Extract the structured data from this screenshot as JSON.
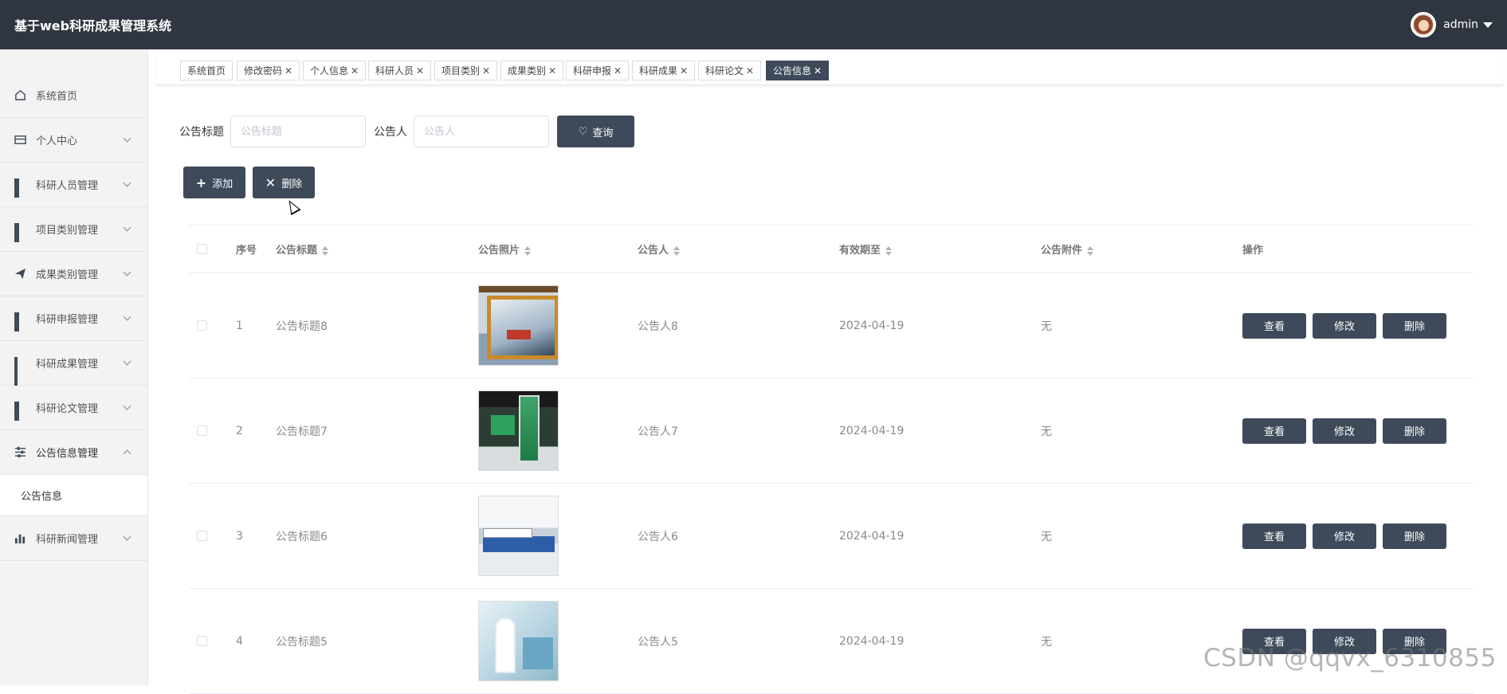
{
  "header": {
    "title": "基于web科研成果管理系统",
    "username": "admin"
  },
  "sidebar": {
    "items": [
      {
        "label": "系统首页",
        "icon": "home-icon"
      },
      {
        "label": "个人中心",
        "icon": "card-icon"
      },
      {
        "label": "科研人员管理",
        "icon": "grid-icon"
      },
      {
        "label": "项目类别管理",
        "icon": "grid-icon"
      },
      {
        "label": "成果类别管理",
        "icon": "send-icon"
      },
      {
        "label": "科研申报管理",
        "icon": "grid-icon"
      },
      {
        "label": "科研成果管理",
        "icon": "grid9-icon"
      },
      {
        "label": "科研论文管理",
        "icon": "grid-icon"
      },
      {
        "label": "公告信息管理",
        "icon": "sliders-icon"
      },
      {
        "label": "科研新闻管理",
        "icon": "bar-chart-icon"
      }
    ],
    "submenu": {
      "label": "公告信息"
    }
  },
  "tabs": [
    {
      "label": "系统首页"
    },
    {
      "label": "修改密码"
    },
    {
      "label": "个人信息"
    },
    {
      "label": "科研人员"
    },
    {
      "label": "项目类别"
    },
    {
      "label": "成果类别"
    },
    {
      "label": "科研申报"
    },
    {
      "label": "科研成果"
    },
    {
      "label": "科研论文"
    },
    {
      "label": "公告信息",
      "active": true
    }
  ],
  "search": {
    "title_label": "公告标题",
    "title_placeholder": "公告标题",
    "person_label": "公告人",
    "person_placeholder": "公告人",
    "query_button": "查询"
  },
  "actions": {
    "add": "添加",
    "delete": "删除"
  },
  "table": {
    "columns": {
      "index": "序号",
      "title": "公告标题",
      "photo": "公告照片",
      "person": "公告人",
      "date": "有效期至",
      "attachment": "公告附件",
      "ops": "操作"
    },
    "rows": [
      {
        "index": "1",
        "title": "公告标题8",
        "person": "公告人8",
        "date": "2024-04-19",
        "attachment": "无"
      },
      {
        "index": "2",
        "title": "公告标题7",
        "person": "公告人7",
        "date": "2024-04-19",
        "attachment": "无"
      },
      {
        "index": "3",
        "title": "公告标题6",
        "person": "公告人6",
        "date": "2024-04-19",
        "attachment": "无"
      },
      {
        "index": "4",
        "title": "公告标题5",
        "person": "公告人5",
        "date": "2024-04-19",
        "attachment": "无"
      }
    ],
    "op_labels": {
      "view": "查看",
      "edit": "修改",
      "delete": "删除"
    }
  },
  "watermark": "CSDN @qqvx_6310855",
  "colors": {
    "topbar": "#2f3640",
    "accent": "#3e4a59"
  }
}
